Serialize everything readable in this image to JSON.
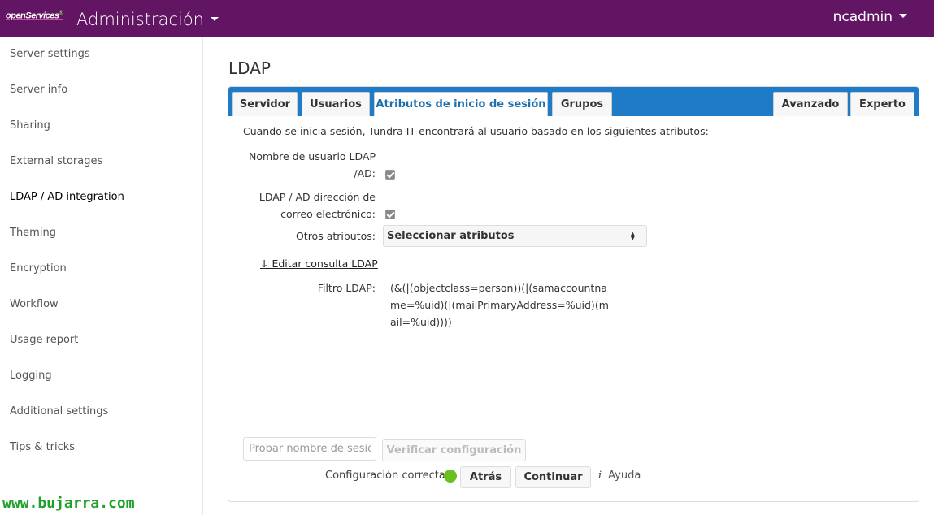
{
  "header": {
    "logo_text": "openServices",
    "logo_sup": "®",
    "app_title": "Administración",
    "user": "ncadmin",
    "bg_color": "#621563"
  },
  "sidebar": {
    "items": [
      {
        "label": "Server settings"
      },
      {
        "label": "Server info"
      },
      {
        "label": "Sharing"
      },
      {
        "label": "External storages"
      },
      {
        "label": "LDAP / AD integration",
        "active": true
      },
      {
        "label": "Theming"
      },
      {
        "label": "Encryption"
      },
      {
        "label": "Workflow"
      },
      {
        "label": "Usage report"
      },
      {
        "label": "Logging"
      },
      {
        "label": "Additional settings"
      },
      {
        "label": "Tips & tricks"
      }
    ]
  },
  "watermark": "www.bujarra.com",
  "main": {
    "title": "LDAP",
    "tabs": [
      {
        "label": "Servidor"
      },
      {
        "label": "Usuarios"
      },
      {
        "label": "Atributos de inicio de sesión",
        "active": true
      },
      {
        "label": "Grupos"
      },
      {
        "label": "Avanzado"
      },
      {
        "label": "Experto"
      }
    ],
    "intro": "Cuando se inicia sesión, Tundra IT encontrará al usuario basado en los siguientes atributos:",
    "fields": {
      "ldap_username_label_1": "Nombre de usuario LDAP",
      "ldap_username_label_2": "/AD:",
      "ldap_username_checked": true,
      "email_label_1": "LDAP / AD dirección de",
      "email_label_2": "correo electrónico:",
      "email_checked": true,
      "other_label": "Otros atributos:",
      "other_select_value": "Seleccionar atributos",
      "edit_query_link": "↓ Editar consulta LDAP",
      "filter_label": "Filtro LDAP:",
      "filter_value": "(&(|(objectclass=person))(|(samaccountname=%uid)(|(mailPrimaryAddress=%uid)(mail=%uid))))"
    },
    "footer": {
      "test_placeholder": "Probar nombre de sesión",
      "verify_button": "Verificar configuración",
      "status_text": "Configuración correcta",
      "status_color": "#67c21f",
      "back_button": "Atrás",
      "continue_button": "Continuar",
      "help_icon": "i",
      "help_label": "Ayuda"
    },
    "accent_color": "#1d7bc7"
  }
}
